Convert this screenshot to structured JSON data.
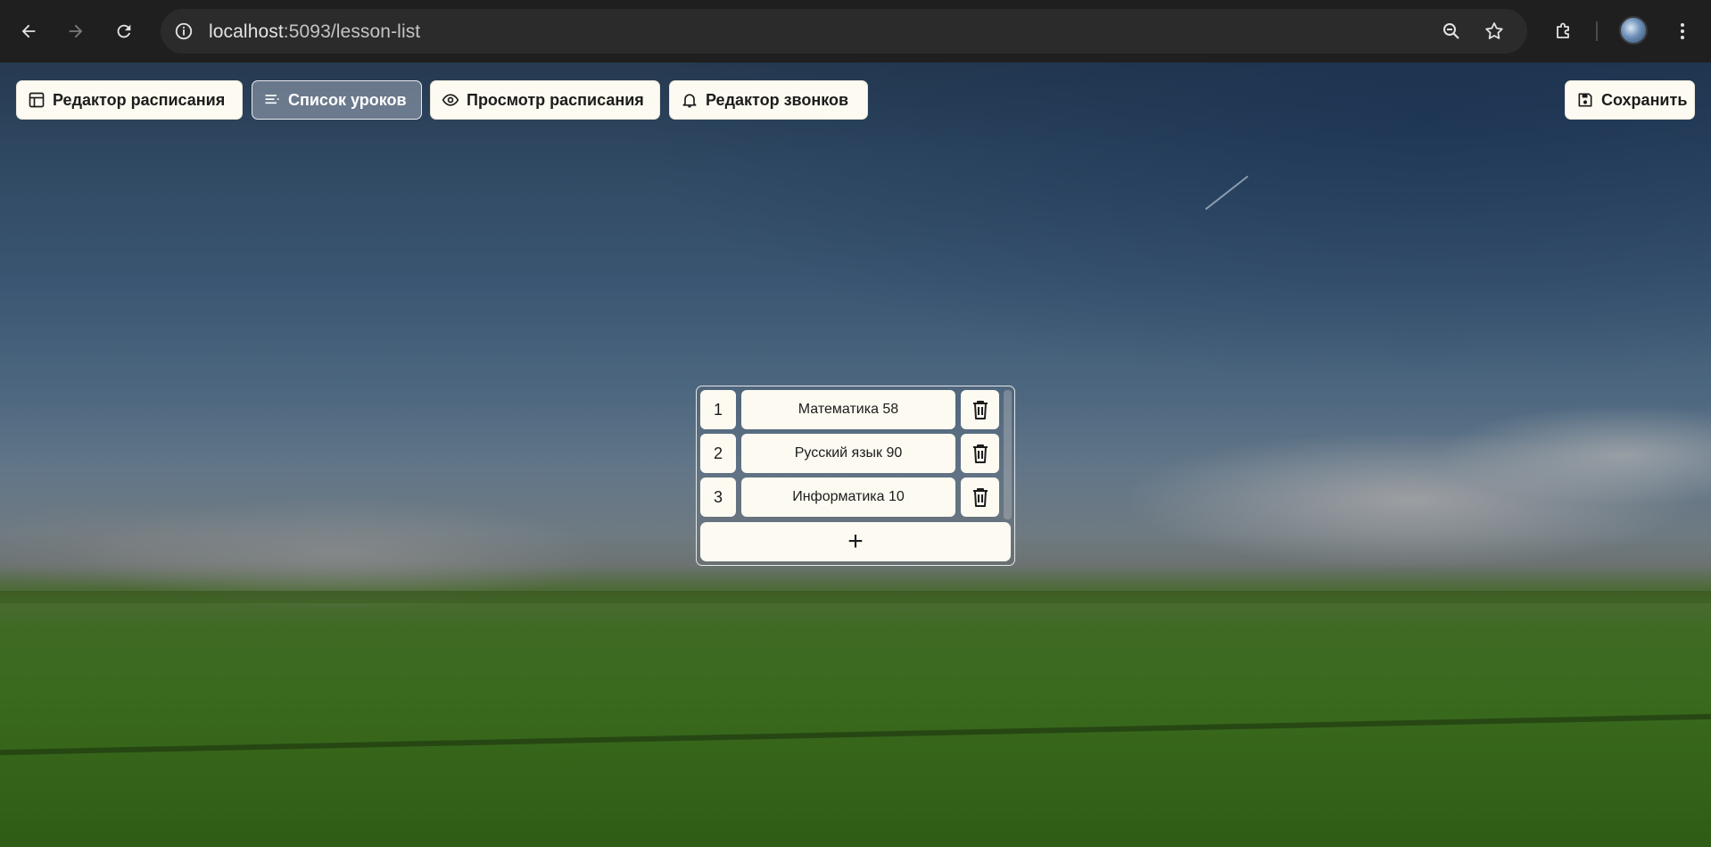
{
  "browser": {
    "url_host": "localhost",
    "url_path": ":5093/lesson-list",
    "back_icon": "arrow-left-icon",
    "forward_icon": "arrow-right-icon",
    "reload_icon": "reload-icon",
    "site_info_icon": "info-icon",
    "zoom_icon": "zoom-out-icon",
    "bookmark_icon": "star-icon",
    "extensions_icon": "puzzle-icon",
    "menu_icon": "kebab-menu-icon"
  },
  "toolbar": {
    "schedule_editor_label": "Редактор расписания",
    "lesson_list_label": "Список уроков",
    "schedule_view_label": "Просмотр расписания",
    "bell_editor_label": "Редактор звонков",
    "save_label": "Сохранить"
  },
  "lessons": [
    {
      "number": "1",
      "name": "Математика 58"
    },
    {
      "number": "2",
      "name": "Русский язык 90"
    },
    {
      "number": "3",
      "name": "Информатика 10"
    }
  ],
  "add_label": "+",
  "colors": {
    "button_bg": "#fdfbf1",
    "chrome_bg": "#1f1f1f",
    "omnibox_bg": "#2b2b2b"
  }
}
